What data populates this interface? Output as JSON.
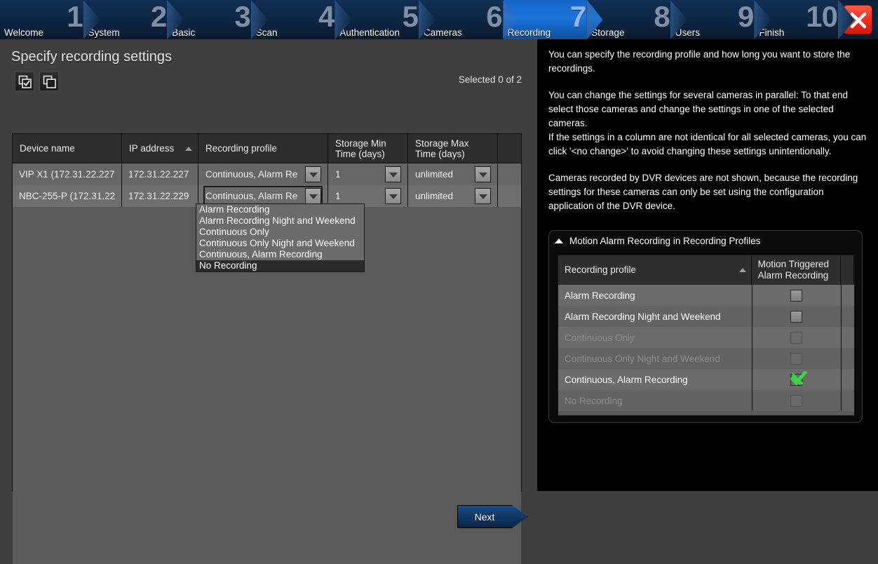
{
  "wizard": {
    "steps": [
      {
        "number": "1",
        "label": "Welcome",
        "active": false
      },
      {
        "number": "2",
        "label": "System",
        "active": false
      },
      {
        "number": "3",
        "label": "Basic",
        "active": false
      },
      {
        "number": "4",
        "label": "Scan",
        "active": false
      },
      {
        "number": "5",
        "label": "Authentication",
        "active": false
      },
      {
        "number": "6",
        "label": "Cameras",
        "active": false
      },
      {
        "number": "7",
        "label": "Recording",
        "active": true
      },
      {
        "number": "8",
        "label": "Storage",
        "active": false
      },
      {
        "number": "9",
        "label": "Users",
        "active": false
      },
      {
        "number": "10",
        "label": "Finish",
        "active": false
      }
    ],
    "close_icon": "close-icon",
    "active_color": "#1c74dd",
    "close_color": "#f0291a"
  },
  "page": {
    "title": "Specify recording settings",
    "selected_count": "Selected 0 of 2",
    "toolbar": [
      {
        "name": "select-all-icon",
        "tooltip": "Select all"
      },
      {
        "name": "deselect-all-icon",
        "tooltip": "Deselect all"
      }
    ]
  },
  "device_table": {
    "columns": [
      {
        "label": "Device name",
        "sorted": false
      },
      {
        "label": "IP address",
        "sorted": true,
        "sort_dir": "asc"
      },
      {
        "label": "Recording profile",
        "sorted": false
      },
      {
        "label": "Storage Min\nTime (days)",
        "sorted": false
      },
      {
        "label": "Storage Max\nTime (days)",
        "sorted": false
      },
      {
        "label": "",
        "sorted": false
      }
    ],
    "column_labels": {
      "device_name": "Device name",
      "ip_address": "IP address",
      "recording_profile": "Recording profile",
      "storage_min_l1": "Storage Min",
      "storage_min_l2": "Time (days)",
      "storage_max_l1": "Storage Max",
      "storage_max_l2": "Time (days)",
      "blank": ""
    },
    "rows": [
      {
        "device_name": "VIP X1 (172.31.22.227",
        "ip_address": "172.31.22.227",
        "recording_profile": "Continuous, Alarm Re",
        "storage_min": "1",
        "storage_max": "unlimited"
      },
      {
        "device_name": "NBC-255-P (172.31.22",
        "ip_address": "172.31.22.229",
        "recording_profile": "Continuous, Alarm Re",
        "storage_min": "1",
        "storage_max": "unlimited"
      }
    ]
  },
  "profile_dropdown": {
    "open": true,
    "items": [
      {
        "label": "Alarm Recording",
        "highlighted": false
      },
      {
        "label": "Alarm Recording Night and Weekend",
        "highlighted": false
      },
      {
        "label": "Continuous Only",
        "highlighted": false
      },
      {
        "label": "Continuous Only Night and Weekend",
        "highlighted": false
      },
      {
        "label": "Continuous, Alarm Recording",
        "highlighted": false
      },
      {
        "label": "No Recording",
        "highlighted": true
      }
    ]
  },
  "help": {
    "paragraphs": [
      "You can specify the recording profile and how long you want to store the recordings.",
      "You can change the settings for several cameras in parallel: To that end select those cameras and change the settings in one of the selected cameras.",
      "If the settings in a column are not identical for all selected cameras, you can click '<no change>' to avoid changing these settings unintentionally.",
      "Cameras recorded by DVR devices are not shown, because the recording settings for these cameras can only be set using the configuration application of the DVR device."
    ]
  },
  "motion_panel": {
    "title": "Motion Alarm Recording in Recording Profiles",
    "collapse_icon": "chevron-up-icon",
    "columns": {
      "profile": "Recording profile",
      "motion_l1": "Motion Triggered",
      "motion_l2": "Alarm Recording"
    },
    "sort_column": "Recording profile",
    "sort_dir": "asc",
    "check_color": "#3dd442",
    "rows": [
      {
        "profile": "Alarm Recording",
        "checked": false,
        "enabled": true
      },
      {
        "profile": "Alarm Recording Night and Weekend",
        "checked": false,
        "enabled": true
      },
      {
        "profile": "Continuous Only",
        "checked": false,
        "enabled": false
      },
      {
        "profile": "Continuous Only Night and Weekend",
        "checked": false,
        "enabled": false
      },
      {
        "profile": "Continuous, Alarm Recording",
        "checked": true,
        "enabled": true
      },
      {
        "profile": "No Recording",
        "checked": false,
        "enabled": false
      }
    ]
  },
  "footer": {
    "next_label": "Next"
  }
}
